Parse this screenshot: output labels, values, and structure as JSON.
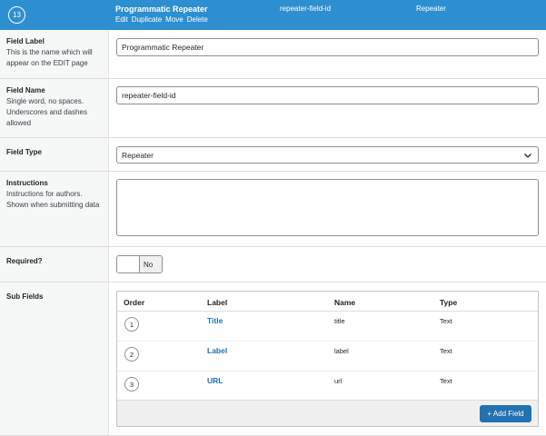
{
  "header": {
    "order": "13",
    "title": "Programmatic Repeater",
    "actions": [
      "Edit",
      "Duplicate",
      "Move",
      "Delete"
    ],
    "name": "repeater-field-id",
    "type": "Repeater",
    "background_color": "#2e8fd0"
  },
  "field_label": {
    "title": "Field Label",
    "description": "This is the name which will appear on the EDIT page",
    "value": "Programmatic Repeater"
  },
  "field_name": {
    "title": "Field Name",
    "description": "Single word, no spaces. Underscores and dashes allowed",
    "value": "repeater-field-id"
  },
  "field_type": {
    "title": "Field Type",
    "selected": "Repeater",
    "icon": "chevron-down-icon"
  },
  "instructions": {
    "title": "Instructions",
    "description": "Instructions for authors. Shown when submitting data",
    "value": ""
  },
  "required": {
    "title": "Required?",
    "toggle_label": "No",
    "checked": false
  },
  "sub_fields": {
    "title": "Sub Fields",
    "columns": [
      "Order",
      "Label",
      "Name",
      "Type"
    ],
    "rows": [
      {
        "order": "1",
        "label": "Title",
        "name": "title",
        "type": "Text"
      },
      {
        "order": "2",
        "label": "Label",
        "name": "label",
        "type": "Text"
      },
      {
        "order": "3",
        "label": "URL",
        "name": "url",
        "type": "Text"
      }
    ],
    "add_button": "+ Add Field",
    "link_color": "#2271b1"
  }
}
